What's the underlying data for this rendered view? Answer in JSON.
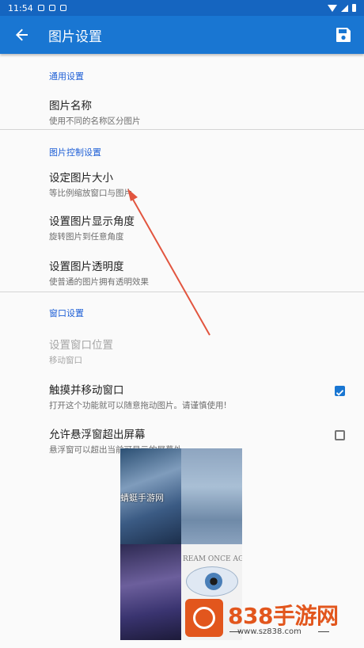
{
  "status_bar": {
    "time": "11:54"
  },
  "app_bar": {
    "title": "图片设置",
    "back_icon": "arrow-back-icon",
    "save_icon": "save-icon"
  },
  "sections": {
    "general": {
      "title": "通用设置",
      "items": [
        {
          "title": "图片名称",
          "summary": "使用不同的名称区分图片"
        }
      ]
    },
    "control": {
      "title": "图片控制设置",
      "items": [
        {
          "title": "设定图片大小",
          "summary": "等比例缩放窗口与图片"
        },
        {
          "title": "设置图片显示角度",
          "summary": "旋转图片到任意角度"
        },
        {
          "title": "设置图片透明度",
          "summary": "使普通的图片拥有透明效果"
        }
      ]
    },
    "window": {
      "title": "窗口设置",
      "items": [
        {
          "title": "设置窗口位置",
          "summary": "移动窗口",
          "enabled": false
        },
        {
          "title": "触摸并移动窗口",
          "summary": "打开这个功能就可以随意拖动图片。请谨慎使用!",
          "checked": true
        },
        {
          "title": "允许悬浮窗超出屏幕",
          "summary": "悬浮窗可以超出当前可显示的屏幕外",
          "checked": false
        }
      ]
    }
  },
  "overlay_image": {
    "caption": "蜻蜓手游网",
    "dream_text": "REAM ONCE AGA"
  },
  "watermark": {
    "brand": "838手游网",
    "url": "www.sz838.com"
  },
  "colors": {
    "primary": "#1976d2",
    "status_bar": "#1565c0",
    "accent": "#1e5fd6",
    "arrow": "#e2553f"
  }
}
